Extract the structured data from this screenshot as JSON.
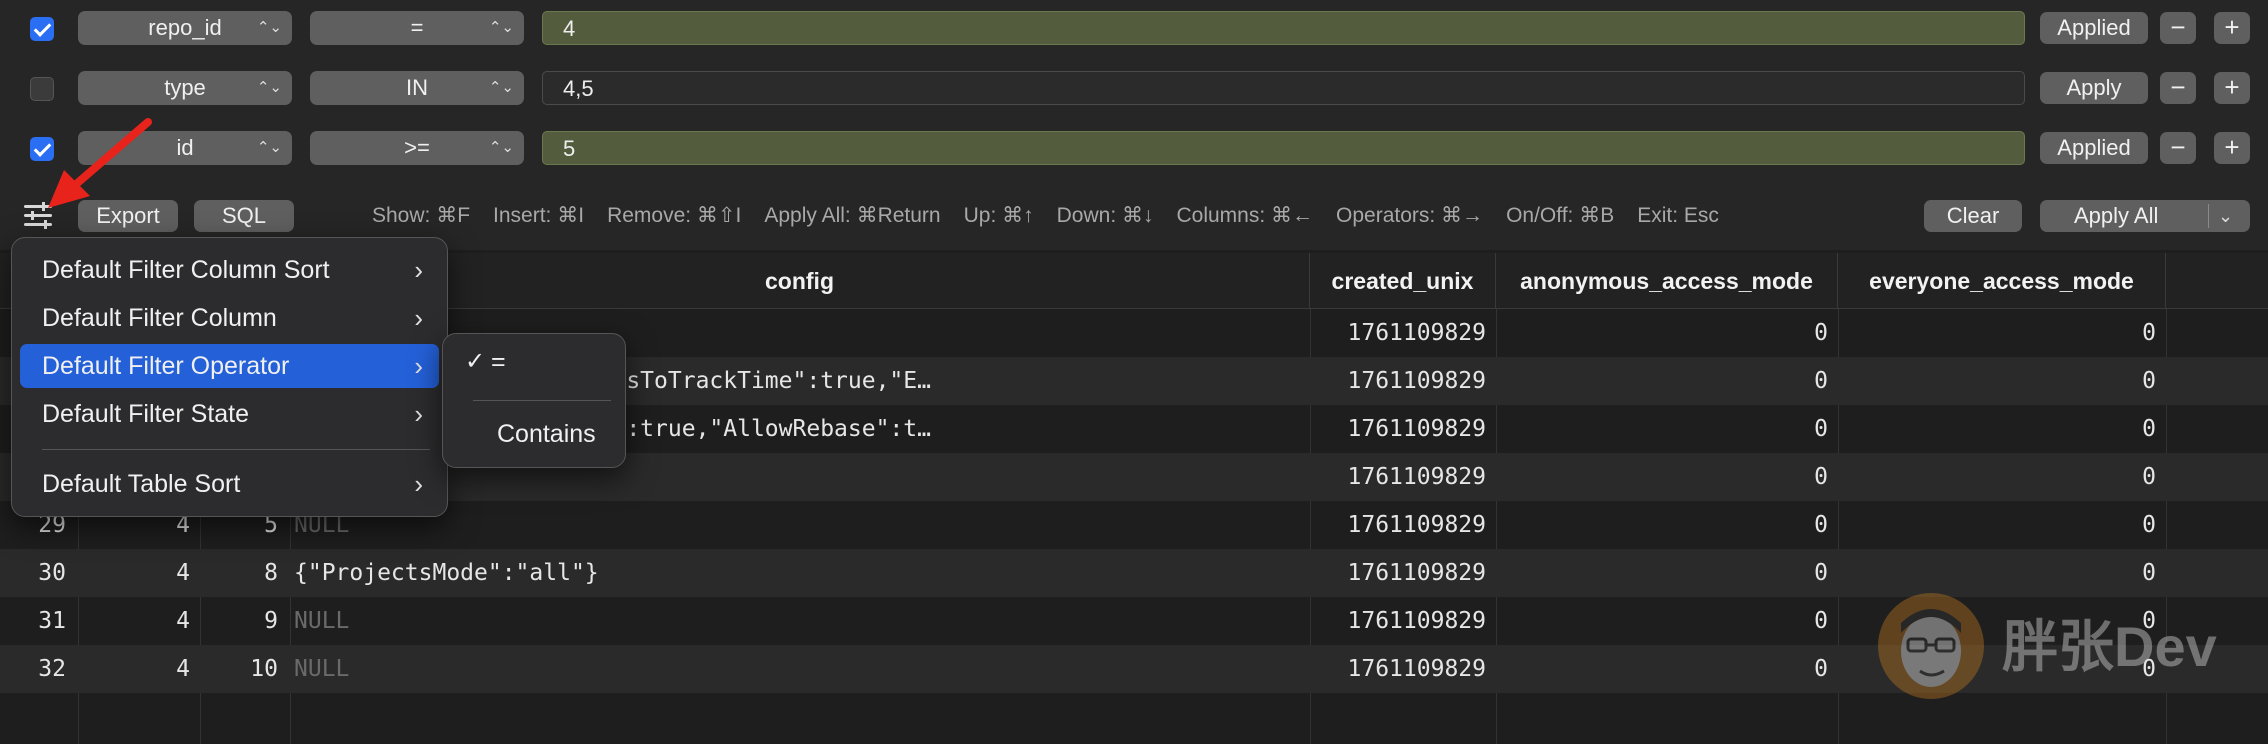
{
  "filters": [
    {
      "enabled": true,
      "column": "repo_id",
      "operator": "=",
      "value": "4",
      "state": "Applied"
    },
    {
      "enabled": false,
      "column": "type",
      "operator": "IN",
      "value": "4,5",
      "state": "Apply"
    },
    {
      "enabled": true,
      "column": "id",
      "operator": ">=",
      "value": "5",
      "state": "Applied"
    }
  ],
  "row_buttons": {
    "remove": "−",
    "add": "+"
  },
  "toolbar": {
    "export": "Export",
    "sql": "SQL",
    "shortcuts": [
      "Show: ⌘F",
      "Insert: ⌘I",
      "Remove: ⌘⇧I",
      "Apply All: ⌘Return",
      "Up: ⌘↑",
      "Down: ⌘↓",
      "Columns: ⌘←",
      "Operators: ⌘→",
      "On/Off: ⌘B",
      "Exit: Esc"
    ],
    "clear": "Clear",
    "apply_all": "Apply All"
  },
  "table": {
    "headers": [
      "config",
      "created_unix",
      "anonymous_access_mode",
      "everyone_access_mode"
    ],
    "rows": [
      {
        "c1": "",
        "c2": "",
        "c3": "",
        "config": "",
        "created": "1761109829",
        "anon": "0",
        "every": "0"
      },
      {
        "c1": "",
        "c2": "",
        "c3": "",
        "config": "ue,\"AllowOnlyContributorsToTrackTime\":true,\"E…",
        "created": "1761109829",
        "anon": "0",
        "every": "0"
      },
      {
        "c1": "",
        "c2": "",
        "c3": "",
        "config": "icts\":false,\"AllowMerge\":true,\"AllowRebase\":t…",
        "created": "1761109829",
        "anon": "0",
        "every": "0"
      },
      {
        "c1": "",
        "c2": "",
        "c3": "",
        "config": "",
        "created": "1761109829",
        "anon": "0",
        "every": "0"
      },
      {
        "c1": "29",
        "c2": "4",
        "c3": "5",
        "config": "NULL",
        "created": "1761109829",
        "anon": "0",
        "every": "0"
      },
      {
        "c1": "30",
        "c2": "4",
        "c3": "8",
        "config": "{\"ProjectsMode\":\"all\"}",
        "created": "1761109829",
        "anon": "0",
        "every": "0"
      },
      {
        "c1": "31",
        "c2": "4",
        "c3": "9",
        "config": "NULL",
        "created": "1761109829",
        "anon": "0",
        "every": "0"
      },
      {
        "c1": "32",
        "c2": "4",
        "c3": "10",
        "config": "NULL",
        "created": "1761109829",
        "anon": "0",
        "every": "0"
      }
    ]
  },
  "context_menu": {
    "items": [
      "Default Filter Column Sort",
      "Default Filter Column",
      "Default Filter Operator",
      "Default Filter State",
      "Default Table Sort"
    ],
    "submenu": {
      "check": "✓",
      "items": [
        "=",
        "Contains"
      ]
    }
  },
  "watermark": "胖张Dev",
  "colors": {
    "accent": "#2460d8",
    "applied_value": "#535d3e",
    "arrow": "#e8231b"
  }
}
